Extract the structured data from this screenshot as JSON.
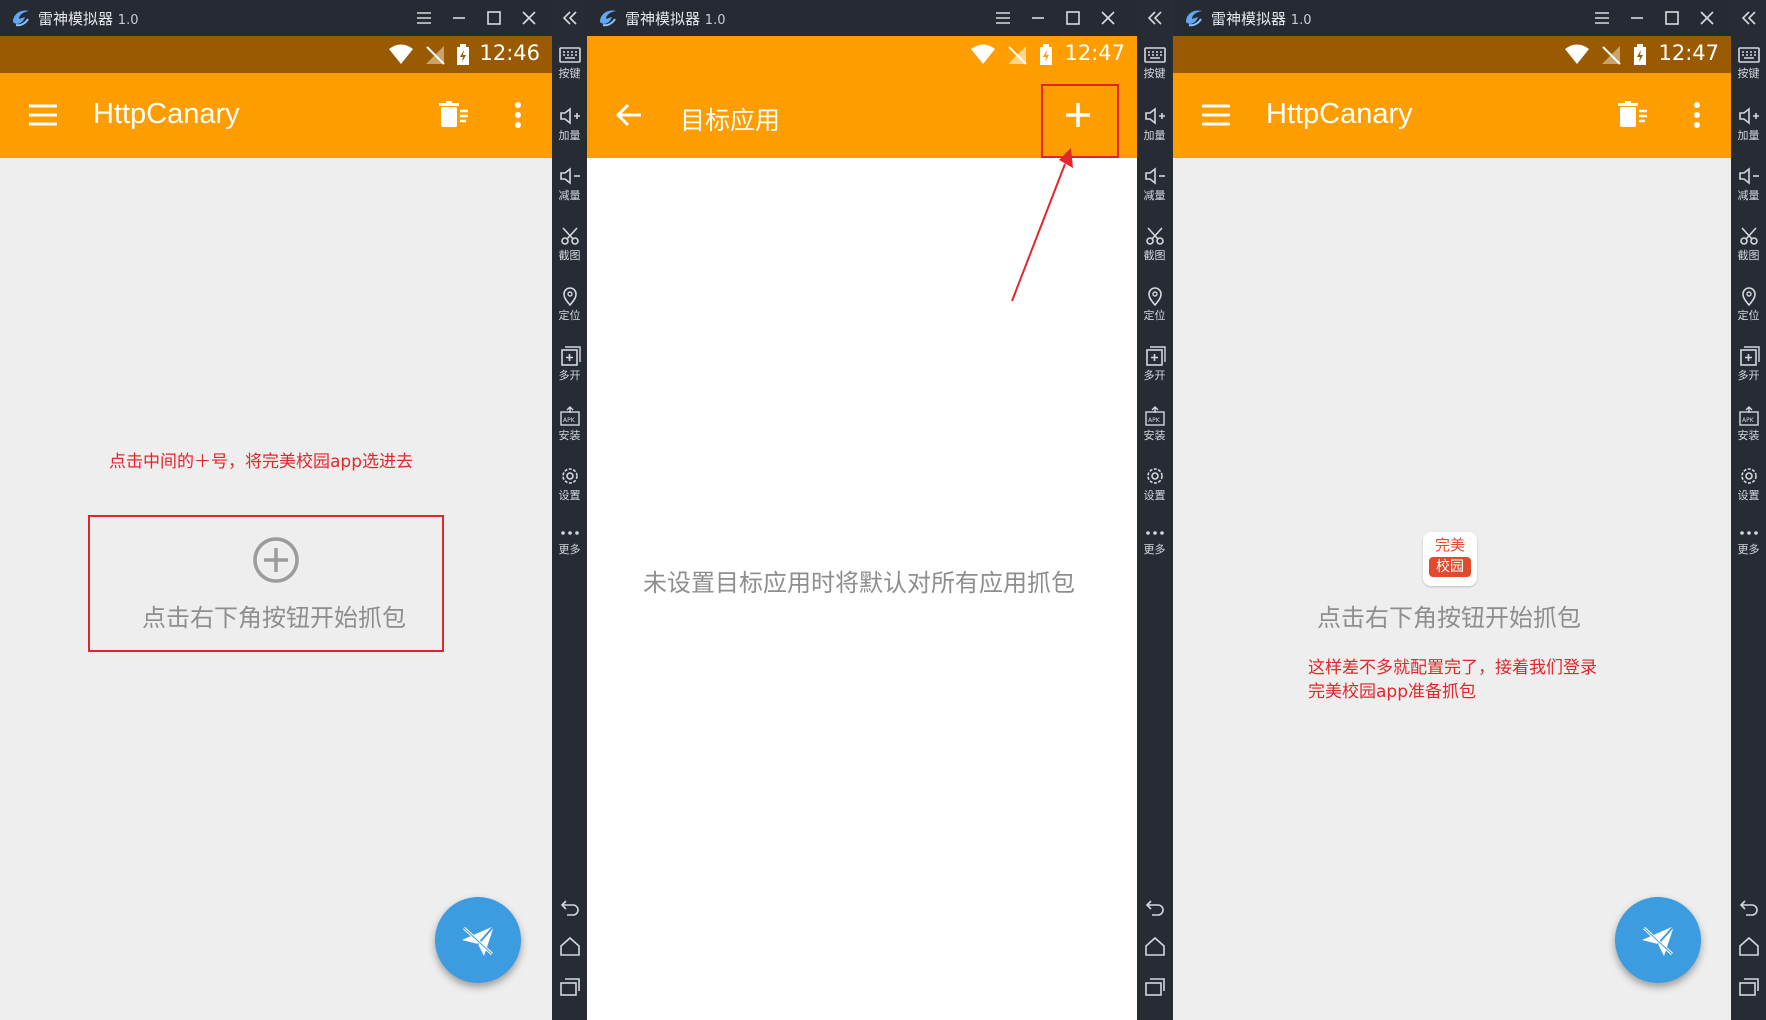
{
  "emulator": {
    "title": "雷神模拟器",
    "version": "1.0"
  },
  "status_bar": {
    "panel1_time": "12:46",
    "panel2_time": "12:47",
    "panel3_time": "12:47"
  },
  "app": {
    "name": "HttpCanary",
    "target_title": "目标应用",
    "empty_hint": "点击右下角按钮开始抓包",
    "target_empty_hint": "未设置目标应用时将默认对所有应用抓包",
    "selected_app_icon_line1": "完美",
    "selected_app_icon_line2": "校园"
  },
  "annotations": {
    "note1": "点击中间的＋号，将完美校园app选进去",
    "note2_line1": "这样差不多就配置完了，接着我们登录",
    "note2_line2": "完美校园app准备抓包"
  },
  "sidebar": {
    "items": [
      {
        "icon": "keyboard-icon",
        "label": "按键"
      },
      {
        "icon": "volume-up-icon",
        "label": "加量"
      },
      {
        "icon": "volume-down-icon",
        "label": "减量"
      },
      {
        "icon": "scissors-icon",
        "label": "截图"
      },
      {
        "icon": "location-icon",
        "label": "定位"
      },
      {
        "icon": "multi-open-icon",
        "label": "多开"
      },
      {
        "icon": "apk-install-icon",
        "label": "安装"
      },
      {
        "icon": "settings-icon",
        "label": "设置"
      },
      {
        "icon": "more-icon",
        "label": "更多"
      }
    ]
  },
  "colors": {
    "appbar": "#fd9d00",
    "statusbar": "#9a5a02",
    "fab": "#3d9be0",
    "annotation_red": "#e3262c"
  }
}
